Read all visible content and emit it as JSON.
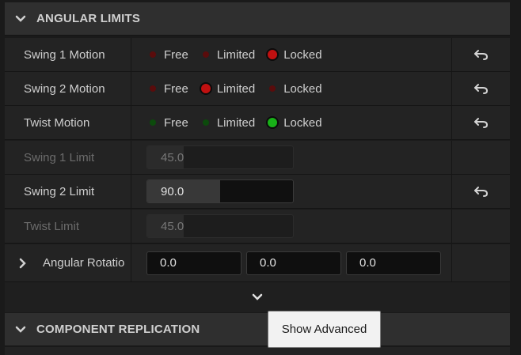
{
  "sections": {
    "angular_limits": {
      "title": "ANGULAR LIMITS"
    },
    "component_replication": {
      "title": "COMPONENT REPLICATION"
    }
  },
  "options": {
    "free": "Free",
    "limited": "Limited",
    "locked": "Locked"
  },
  "rows": {
    "swing1_motion": {
      "label": "Swing 1 Motion",
      "selected": "Locked"
    },
    "swing2_motion": {
      "label": "Swing 2 Motion",
      "selected": "Limited"
    },
    "twist_motion": {
      "label": "Twist Motion",
      "selected": "Locked"
    },
    "swing1_limit": {
      "label": "Swing 1 Limit",
      "value": "45.0",
      "fraction": 0.25,
      "enabled": false
    },
    "swing2_limit": {
      "label": "Swing 2 Limit",
      "value": "90.0",
      "fraction": 0.5,
      "enabled": true
    },
    "twist_limit": {
      "label": "Twist Limit",
      "value": "45.0",
      "fraction": 0.25,
      "enabled": false
    },
    "angular_rotation": {
      "label": "Angular Rotatio",
      "x": "0.0",
      "y": "0.0",
      "z": "0.0"
    }
  },
  "tooltip": {
    "text": "Show Advanced"
  },
  "colors": {
    "red_dot": "#5a0c0c",
    "red_selected": "#c01010",
    "green_dot": "#0c4a0c",
    "green_selected": "#18b018"
  },
  "icons": {
    "reset": "reset-arrow-icon",
    "expand": "chevron-down-icon",
    "collapsed": "chevron-right-icon"
  }
}
